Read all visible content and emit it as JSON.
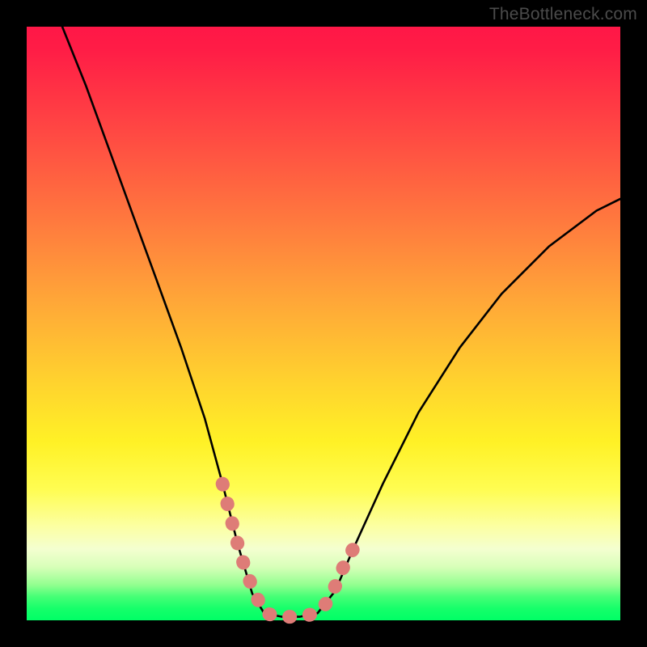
{
  "watermark": "TheBottleneck.com",
  "chart_data": {
    "type": "line",
    "title": "",
    "xlabel": "",
    "ylabel": "",
    "xlim": [
      0,
      100
    ],
    "ylim": [
      0,
      100
    ],
    "grid": false,
    "legend": false,
    "series": [
      {
        "name": "main-curve",
        "color": "#000000",
        "x": [
          6,
          10,
          14,
          18,
          22,
          26,
          30,
          33,
          35.5,
          38,
          40,
          43,
          46,
          49,
          52,
          55,
          60,
          66,
          73,
          80,
          88,
          96,
          100
        ],
        "y": [
          100,
          90,
          79,
          68,
          57,
          46,
          34,
          23,
          13,
          4.5,
          1.2,
          0.6,
          0.6,
          1.2,
          5,
          12,
          23,
          35,
          46,
          55,
          63,
          69,
          71
        ]
      },
      {
        "name": "valley-marker",
        "color": "#e57373",
        "style": "thick-rounded",
        "x": [
          33,
          34.2,
          35.5,
          37,
          38.5,
          40,
          43,
          46,
          49,
          51,
          52.5,
          54,
          55
        ],
        "y": [
          23,
          18,
          13,
          8,
          4.5,
          1.2,
          0.6,
          0.6,
          1.2,
          3.5,
          7,
          10.5,
          12
        ]
      }
    ],
    "gradient_stops": [
      {
        "pos": 0,
        "color": "#ff1747"
      },
      {
        "pos": 18,
        "color": "#ff4943"
      },
      {
        "pos": 33,
        "color": "#ff7a3e"
      },
      {
        "pos": 46,
        "color": "#ffa638"
      },
      {
        "pos": 60,
        "color": "#ffd32e"
      },
      {
        "pos": 78,
        "color": "#fffd52"
      },
      {
        "pos": 88,
        "color": "#f4ffd0"
      },
      {
        "pos": 94,
        "color": "#93ff90"
      },
      {
        "pos": 100,
        "color": "#00ff66"
      }
    ]
  }
}
